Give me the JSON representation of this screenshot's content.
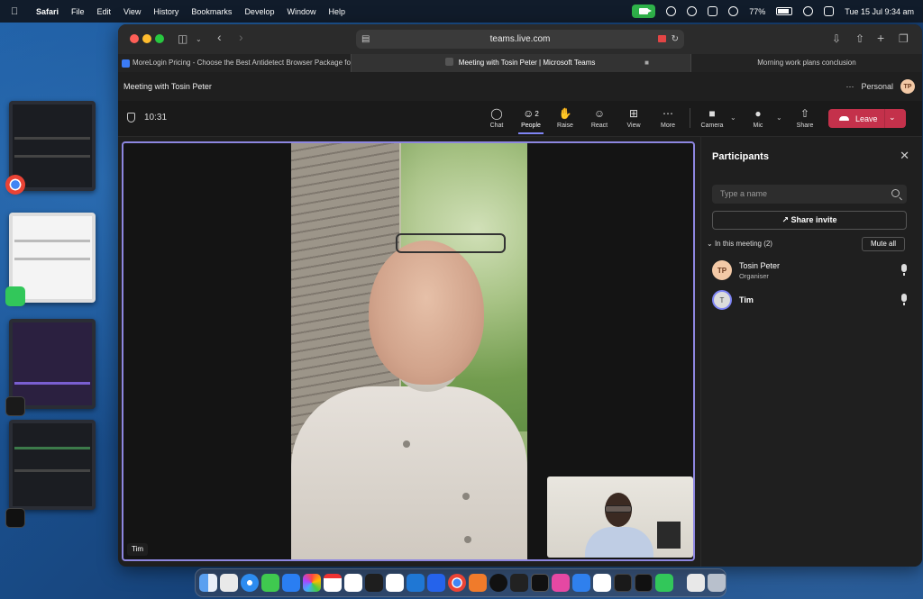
{
  "menubar": {
    "app": "Safari",
    "items": [
      "File",
      "Edit",
      "View",
      "History",
      "Bookmarks",
      "Develop",
      "Window",
      "Help"
    ],
    "battery": "77%",
    "datetime": "Tue 15 Jul  9:34 am"
  },
  "browser": {
    "url": "teams.live.com",
    "tabs": [
      {
        "label": "MoreLogin Pricing - Choose the Best Antidetect Browser Package for Your..."
      },
      {
        "label": "Meeting with Tosin Peter | Microsoft Teams"
      },
      {
        "label": "Morning work plans conclusion"
      }
    ]
  },
  "teams": {
    "meeting_title": "Meeting with Tosin Peter",
    "more_label": "···",
    "account_label": "Personal",
    "account_initials": "TP",
    "timer": "10:31",
    "toolbar": {
      "chat": "Chat",
      "people": "People",
      "people_count": "2",
      "raise": "Raise",
      "react": "React",
      "view": "View",
      "more": "More",
      "camera": "Camera",
      "mic": "Mic",
      "share": "Share",
      "leave": "Leave"
    },
    "video": {
      "main_label": "Tim"
    },
    "participants": {
      "title": "Participants",
      "search_placeholder": "Type a name",
      "share_invite": "Share invite",
      "in_meeting": "In this meeting (2)",
      "mute_all": "Mute all",
      "list": [
        {
          "initials": "TP",
          "name": "Tosin Peter",
          "role": "Organiser"
        },
        {
          "initials": "T",
          "name": "Tim",
          "role": ""
        }
      ]
    }
  },
  "colors": {
    "accent": "#7f85f5",
    "leave": "#c4314b",
    "facetime": "#2fb34a"
  }
}
